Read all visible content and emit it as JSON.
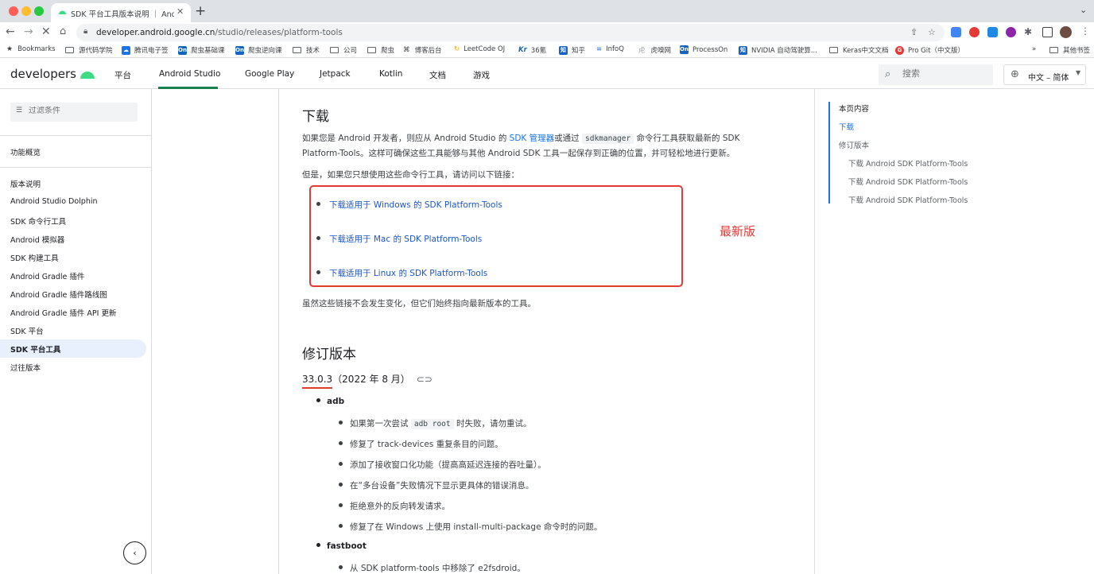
{
  "browser": {
    "tab_title": "SDK 平台工具版本说明 ｜ Android",
    "url_host": "developer.android.google.cn",
    "url_path": "/studio/releases/platform-tools",
    "bookmarks": [
      {
        "label": "Bookmarks",
        "color": "#3c4043"
      },
      {
        "label": "源代码学院",
        "color": "#5f6368"
      },
      {
        "label": "腾讯电子签",
        "color": "#1a73e8"
      },
      {
        "label": "爬虫基础课",
        "color": "#1565c0"
      },
      {
        "label": "爬虫逆向课",
        "color": "#1565c0"
      },
      {
        "label": "技术",
        "color": "#5f6368"
      },
      {
        "label": "公司",
        "color": "#5f6368"
      },
      {
        "label": "爬虫",
        "color": "#5f6368"
      },
      {
        "label": "博客后台",
        "color": "#3c4043"
      },
      {
        "label": "LeetCode OJ",
        "color": "#f4a100"
      },
      {
        "label": "36氪",
        "color": "#1565c0"
      },
      {
        "label": "知乎",
        "color": "#1565c0"
      },
      {
        "label": "InfoQ",
        "color": "#1a73e8"
      },
      {
        "label": "虎嗅网",
        "color": "#5f6368"
      },
      {
        "label": "ProcessOn",
        "color": "#1565c0"
      },
      {
        "label": "NVIDIA 自动驾驶算...",
        "color": "#1565c0"
      },
      {
        "label": "Keras中文文档",
        "color": "#5f6368"
      },
      {
        "label": "Pro Git（中文版）",
        "color": "#e53935"
      }
    ],
    "bookmarks_overflow": "»",
    "other_bookmarks": "其他书签"
  },
  "header": {
    "logo": "developers",
    "nav": [
      "平台",
      "Android Studio",
      "Google Play",
      "Jetpack",
      "Kotlin",
      "文档",
      "游戏"
    ],
    "search_placeholder": "搜索",
    "language": "中文 – 简体"
  },
  "leftnav": {
    "filter_placeholder": "过滤条件",
    "overview": "功能概览",
    "section_title": "版本说明",
    "items": [
      "Android Studio Dolphin",
      "SDK 命令行工具",
      "Android 模拟器",
      "SDK 构建工具",
      "Android Gradle 插件",
      "Android Gradle 插件路线图",
      "Android Gradle 插件 API 更新",
      "SDK 平台",
      "SDK 平台工具",
      "过往版本"
    ],
    "active_index": 8
  },
  "main": {
    "download_heading": "下载",
    "intro_a": "如果您是 Android 开发者，则应从 Android Studio 的 ",
    "intro_link": "SDK 管理器",
    "intro_b": "或通过 ",
    "intro_code": "sdkmanager",
    "intro_c": " 命令行工具获取最新的 SDK",
    "intro_line2": "Platform-Tools。这样可确保这些工具能够与其他 Android SDK 工具一起保存到正确的位置，并可轻松地进行更新。",
    "but_text": "但是，如果您只想使用这些命令行工具，请访问以下链接：",
    "download_links": [
      "下载适用于 Windows 的 SDK Platform-Tools",
      "下载适用于 Mac 的 SDK Platform-Tools",
      "下载适用于 Linux 的 SDK Platform-Tools"
    ],
    "annotation": "最新版",
    "stable_note": "虽然这些链接不会发生变化，但它们始终指向最新版本的工具。",
    "revisions_heading": "修订版本",
    "version_number": "33.0.3",
    "version_date": "（2022 年 8 月）",
    "adb_label": "adb",
    "adb_item1_a": "如果第一次尝试 ",
    "adb_item1_code": "adb root",
    "adb_item1_b": " 时失败，请勿重试。",
    "adb_items": [
      "修复了 track-devices 重复条目的问题。",
      "添加了接收窗口化功能（提高高延迟连接的吞吐量）。",
      "在“多台设备”失败情况下显示更具体的错误消息。",
      "拒绝意外的反向转发请求。",
      "修复了在 Windows 上使用 install-multi-package 命令时的问题。"
    ],
    "fastboot_label": "fastboot",
    "fastboot_items": [
      "从 SDK platform-tools 中移除了 e2fsdroid。"
    ]
  },
  "toc": {
    "title": "本页内容",
    "items": [
      "下载",
      "修订版本",
      "下载 Android SDK Platform-Tools",
      "下载 Android SDK Platform-Tools",
      "下载 Android SDK Platform-Tools"
    ]
  }
}
